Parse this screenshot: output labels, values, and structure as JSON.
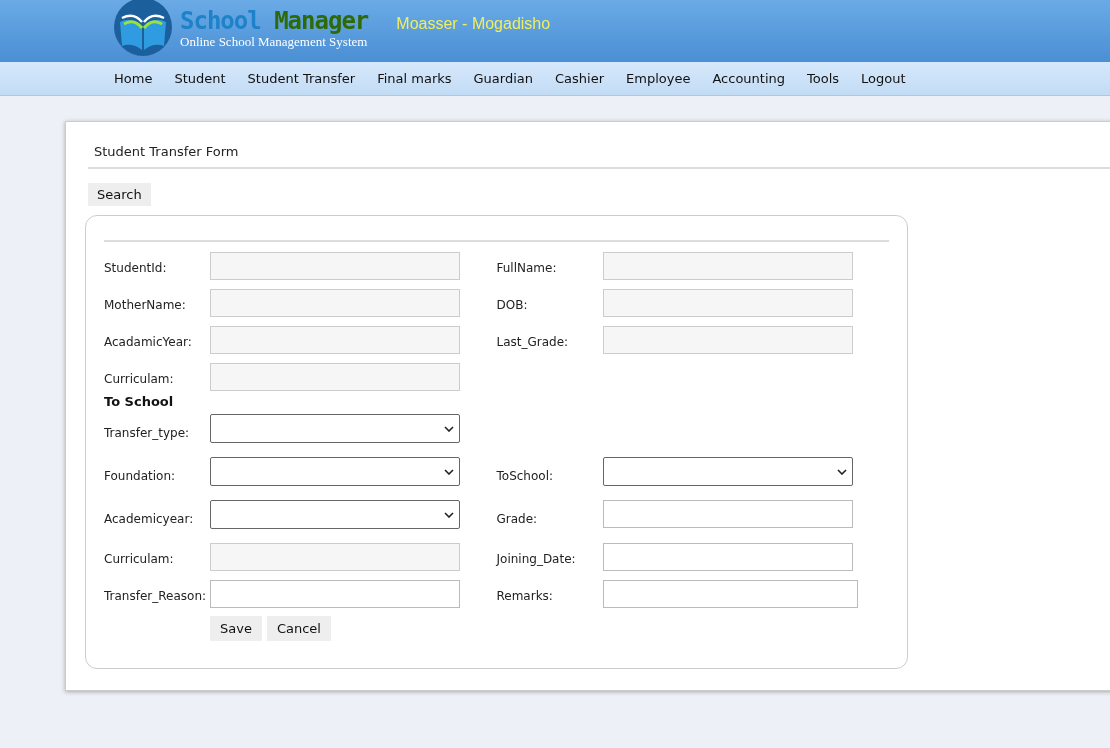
{
  "header": {
    "logo_title_first": "School",
    "logo_title_second": "Manager",
    "logo_subtitle": "Online School Management System",
    "school_name": "Moasser - Mogadisho"
  },
  "nav": [
    {
      "label": "Home"
    },
    {
      "label": "Student"
    },
    {
      "label": "Student Transfer"
    },
    {
      "label": "Final marks"
    },
    {
      "label": "Guardian"
    },
    {
      "label": "Cashier"
    },
    {
      "label": "Employee"
    },
    {
      "label": "Accounting"
    },
    {
      "label": "Tools"
    },
    {
      "label": "Logout"
    }
  ],
  "form": {
    "title": "Student Transfer Form",
    "search_button": "Search",
    "rows": [
      {
        "kind": "fields",
        "cells": [
          {
            "label": "StudentId:",
            "kind": "readonly"
          },
          {
            "label": "FullName:",
            "kind": "readonly"
          }
        ]
      },
      {
        "kind": "fields",
        "cells": [
          {
            "label": "MotherName:",
            "kind": "readonly"
          },
          {
            "label": "DOB:",
            "kind": "readonly"
          }
        ]
      },
      {
        "kind": "fields",
        "cells": [
          {
            "label": "AcadamicYear:",
            "kind": "readonly"
          },
          {
            "label": "Last_Grade:",
            "kind": "readonly"
          }
        ]
      },
      {
        "kind": "fields",
        "cells": [
          {
            "label": "Curriculam:",
            "kind": "readonly"
          }
        ]
      },
      {
        "kind": "heading",
        "text": "To School"
      },
      {
        "kind": "fields",
        "cells": [
          {
            "label": "Transfer_type:",
            "kind": "select"
          }
        ]
      },
      {
        "kind": "fields",
        "cells": [
          {
            "label": "Foundation:",
            "kind": "select"
          },
          {
            "label": "ToSchool:",
            "kind": "select"
          }
        ]
      },
      {
        "kind": "fields",
        "cells": [
          {
            "label": "Academicyear:",
            "kind": "select"
          },
          {
            "label": "Grade:",
            "kind": "text"
          }
        ]
      },
      {
        "kind": "fields",
        "cells": [
          {
            "label": "Curriculam:",
            "kind": "readonly"
          },
          {
            "label": "Joining_Date:",
            "kind": "text"
          }
        ]
      },
      {
        "kind": "fields",
        "cells": [
          {
            "label": "Transfer_Reason:",
            "kind": "text"
          },
          {
            "label": "Remarks:",
            "kind": "wide-text"
          }
        ]
      }
    ],
    "buttons": [
      "Save",
      "Cancel"
    ]
  }
}
